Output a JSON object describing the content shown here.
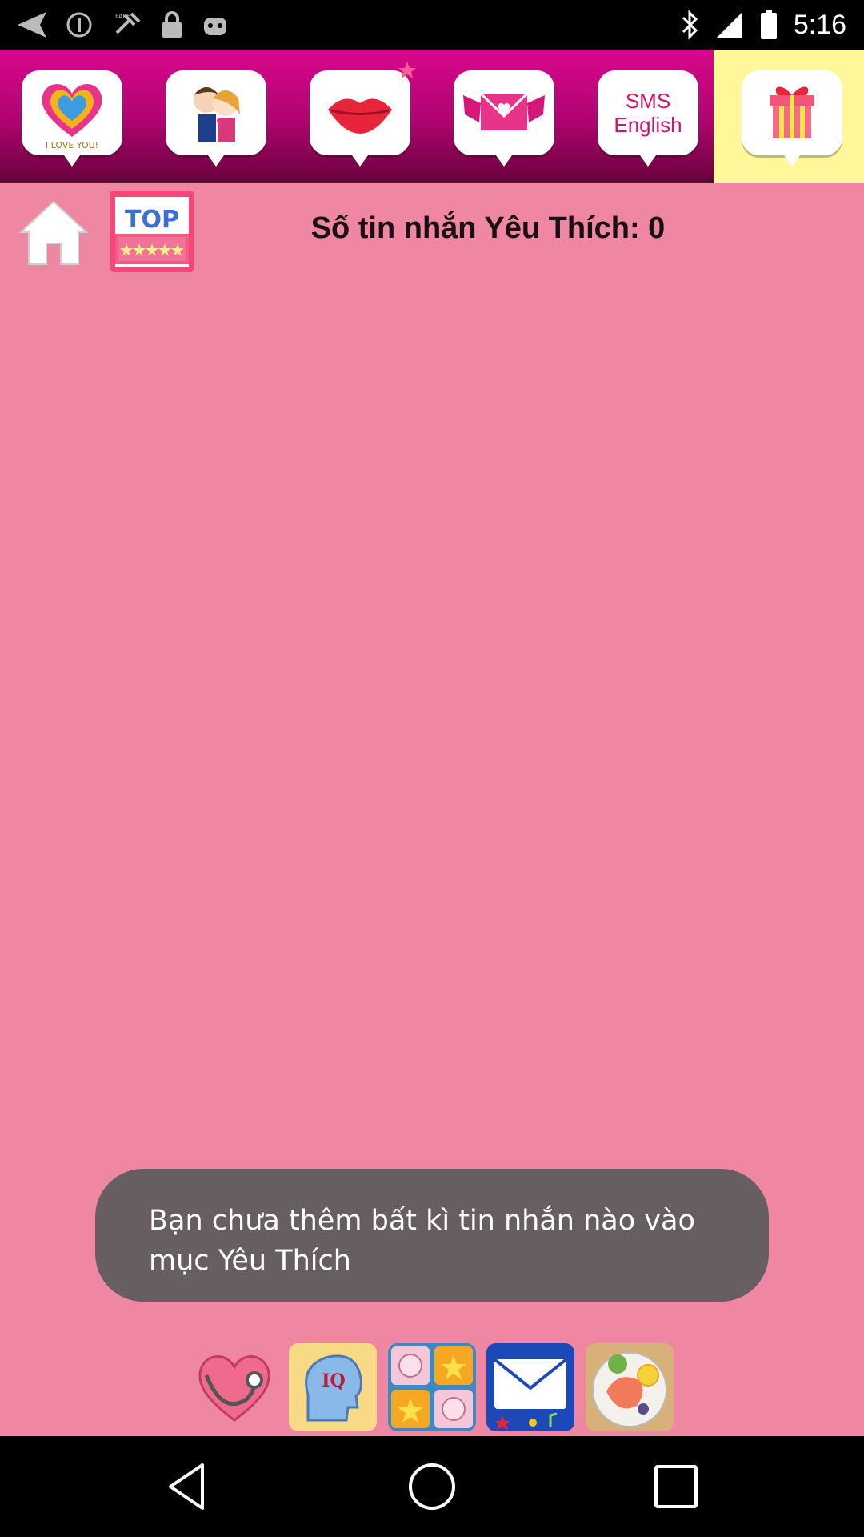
{
  "status_bar": {
    "time": "5:16",
    "left_icons": [
      "back-arrow-icon",
      "info-icon",
      "fake-gps-icon",
      "lock-icon",
      "android-icon"
    ],
    "right_icons": [
      "bluetooth-icon",
      "signal-icon",
      "battery-icon"
    ]
  },
  "tabs": [
    {
      "name": "i-love-you",
      "label": "I LOVE YOU!"
    },
    {
      "name": "couple"
    },
    {
      "name": "lips"
    },
    {
      "name": "love-letter"
    },
    {
      "name": "sms-english",
      "line1": "SMS",
      "line2": "English"
    },
    {
      "name": "gift",
      "active": true
    }
  ],
  "toolbar": {
    "top_label": "TOP",
    "favorite_count_text": "Số tin nhắn Yêu Thích: 0"
  },
  "toast": {
    "message": "Bạn chưa thêm bất kì tin nhắn nào vào mục Yêu Thích"
  },
  "promo_apps": [
    {
      "name": "heart-stethoscope-app"
    },
    {
      "name": "iq-test-app",
      "label": "IQ"
    },
    {
      "name": "pig-puzzle-app"
    },
    {
      "name": "mail-app"
    },
    {
      "name": "food-app"
    }
  ],
  "colors": {
    "background": "#ef87a3",
    "tabbar": "#c0057a",
    "active_tab": "#fff79a",
    "toast": "#675e62"
  }
}
